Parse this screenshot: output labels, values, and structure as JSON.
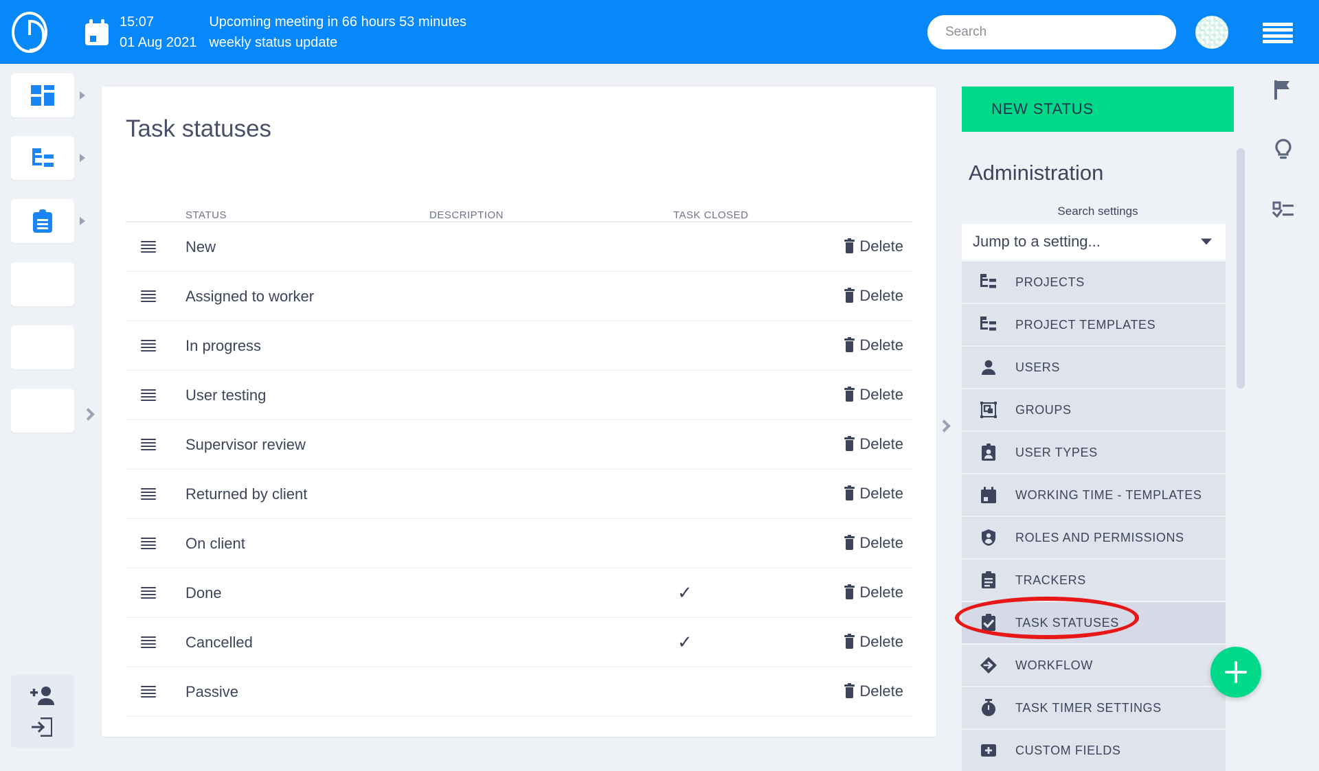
{
  "topbar": {
    "logo_name": "app-logo",
    "time": "15:07",
    "date": "01 Aug 2021",
    "meeting_line1": "Upcoming meeting in 66 hours 53 minutes",
    "meeting_line2": "weekly status update",
    "search_placeholder": "Search",
    "search_value": "",
    "accent_color": "#0688fa"
  },
  "left_rail": {
    "items": [
      {
        "icon": "dashboard-icon",
        "has_arrow": true
      },
      {
        "icon": "project-tree-icon",
        "has_arrow": true
      },
      {
        "icon": "clipboard-icon",
        "has_arrow": true
      },
      {
        "icon": "blank-icon",
        "has_arrow": false
      },
      {
        "icon": "blank-icon",
        "has_arrow": false
      },
      {
        "icon": "blank-icon",
        "has_arrow": false
      }
    ],
    "bottom_icons": [
      "add-user-icon",
      "sign-in-icon"
    ],
    "expand_icon": "chevron-right-icon"
  },
  "main": {
    "title": "Task statuses",
    "columns": [
      "STATUS",
      "DESCRIPTION",
      "TASK CLOSED"
    ],
    "delete_label": "Delete",
    "check_glyph": "✓",
    "rows": [
      {
        "status": "New",
        "description": "",
        "task_closed": false
      },
      {
        "status": "Assigned to worker",
        "description": "",
        "task_closed": false
      },
      {
        "status": "In progress",
        "description": "",
        "task_closed": false
      },
      {
        "status": "User testing",
        "description": "",
        "task_closed": false
      },
      {
        "status": "Supervisor review",
        "description": "",
        "task_closed": false
      },
      {
        "status": "Returned by client",
        "description": "",
        "task_closed": false
      },
      {
        "status": "On client",
        "description": "",
        "task_closed": false
      },
      {
        "status": "Done",
        "description": "",
        "task_closed": true
      },
      {
        "status": "Cancelled",
        "description": "",
        "task_closed": true
      },
      {
        "status": "Passive",
        "description": "",
        "task_closed": false
      }
    ]
  },
  "admin": {
    "new_status_label": "NEW STATUS",
    "new_status_color": "#00d88a",
    "title": "Administration",
    "search_settings_label": "Search settings",
    "jump_placeholder": "Jump to a setting...",
    "items": [
      {
        "label": "PROJECTS",
        "icon": "project-tree-icon",
        "active": false
      },
      {
        "label": "PROJECT TEMPLATES",
        "icon": "project-tree-icon",
        "active": false
      },
      {
        "label": "USERS",
        "icon": "user-icon",
        "active": false
      },
      {
        "label": "GROUPS",
        "icon": "groups-icon",
        "active": false
      },
      {
        "label": "USER TYPES",
        "icon": "user-badge-icon",
        "active": false
      },
      {
        "label": "WORKING TIME - TEMPLATES",
        "icon": "calendar-icon",
        "active": false
      },
      {
        "label": "ROLES AND PERMISSIONS",
        "icon": "shield-user-icon",
        "active": false
      },
      {
        "label": "TRACKERS",
        "icon": "clipboard-icon",
        "active": false
      },
      {
        "label": "TASK STATUSES",
        "icon": "clipboard-check-icon",
        "active": true
      },
      {
        "label": "WORKFLOW",
        "icon": "workflow-icon",
        "active": false
      },
      {
        "label": "TASK TIMER SETTINGS",
        "icon": "stopwatch-icon",
        "active": false
      },
      {
        "label": "CUSTOM FIELDS",
        "icon": "custom-fields-icon",
        "active": false
      }
    ],
    "annotation_color": "#e81717",
    "fab_icon": "plus-icon"
  },
  "right_rail": {
    "items": [
      "flag-icon",
      "lightbulb-icon",
      "checklist-icon"
    ]
  }
}
